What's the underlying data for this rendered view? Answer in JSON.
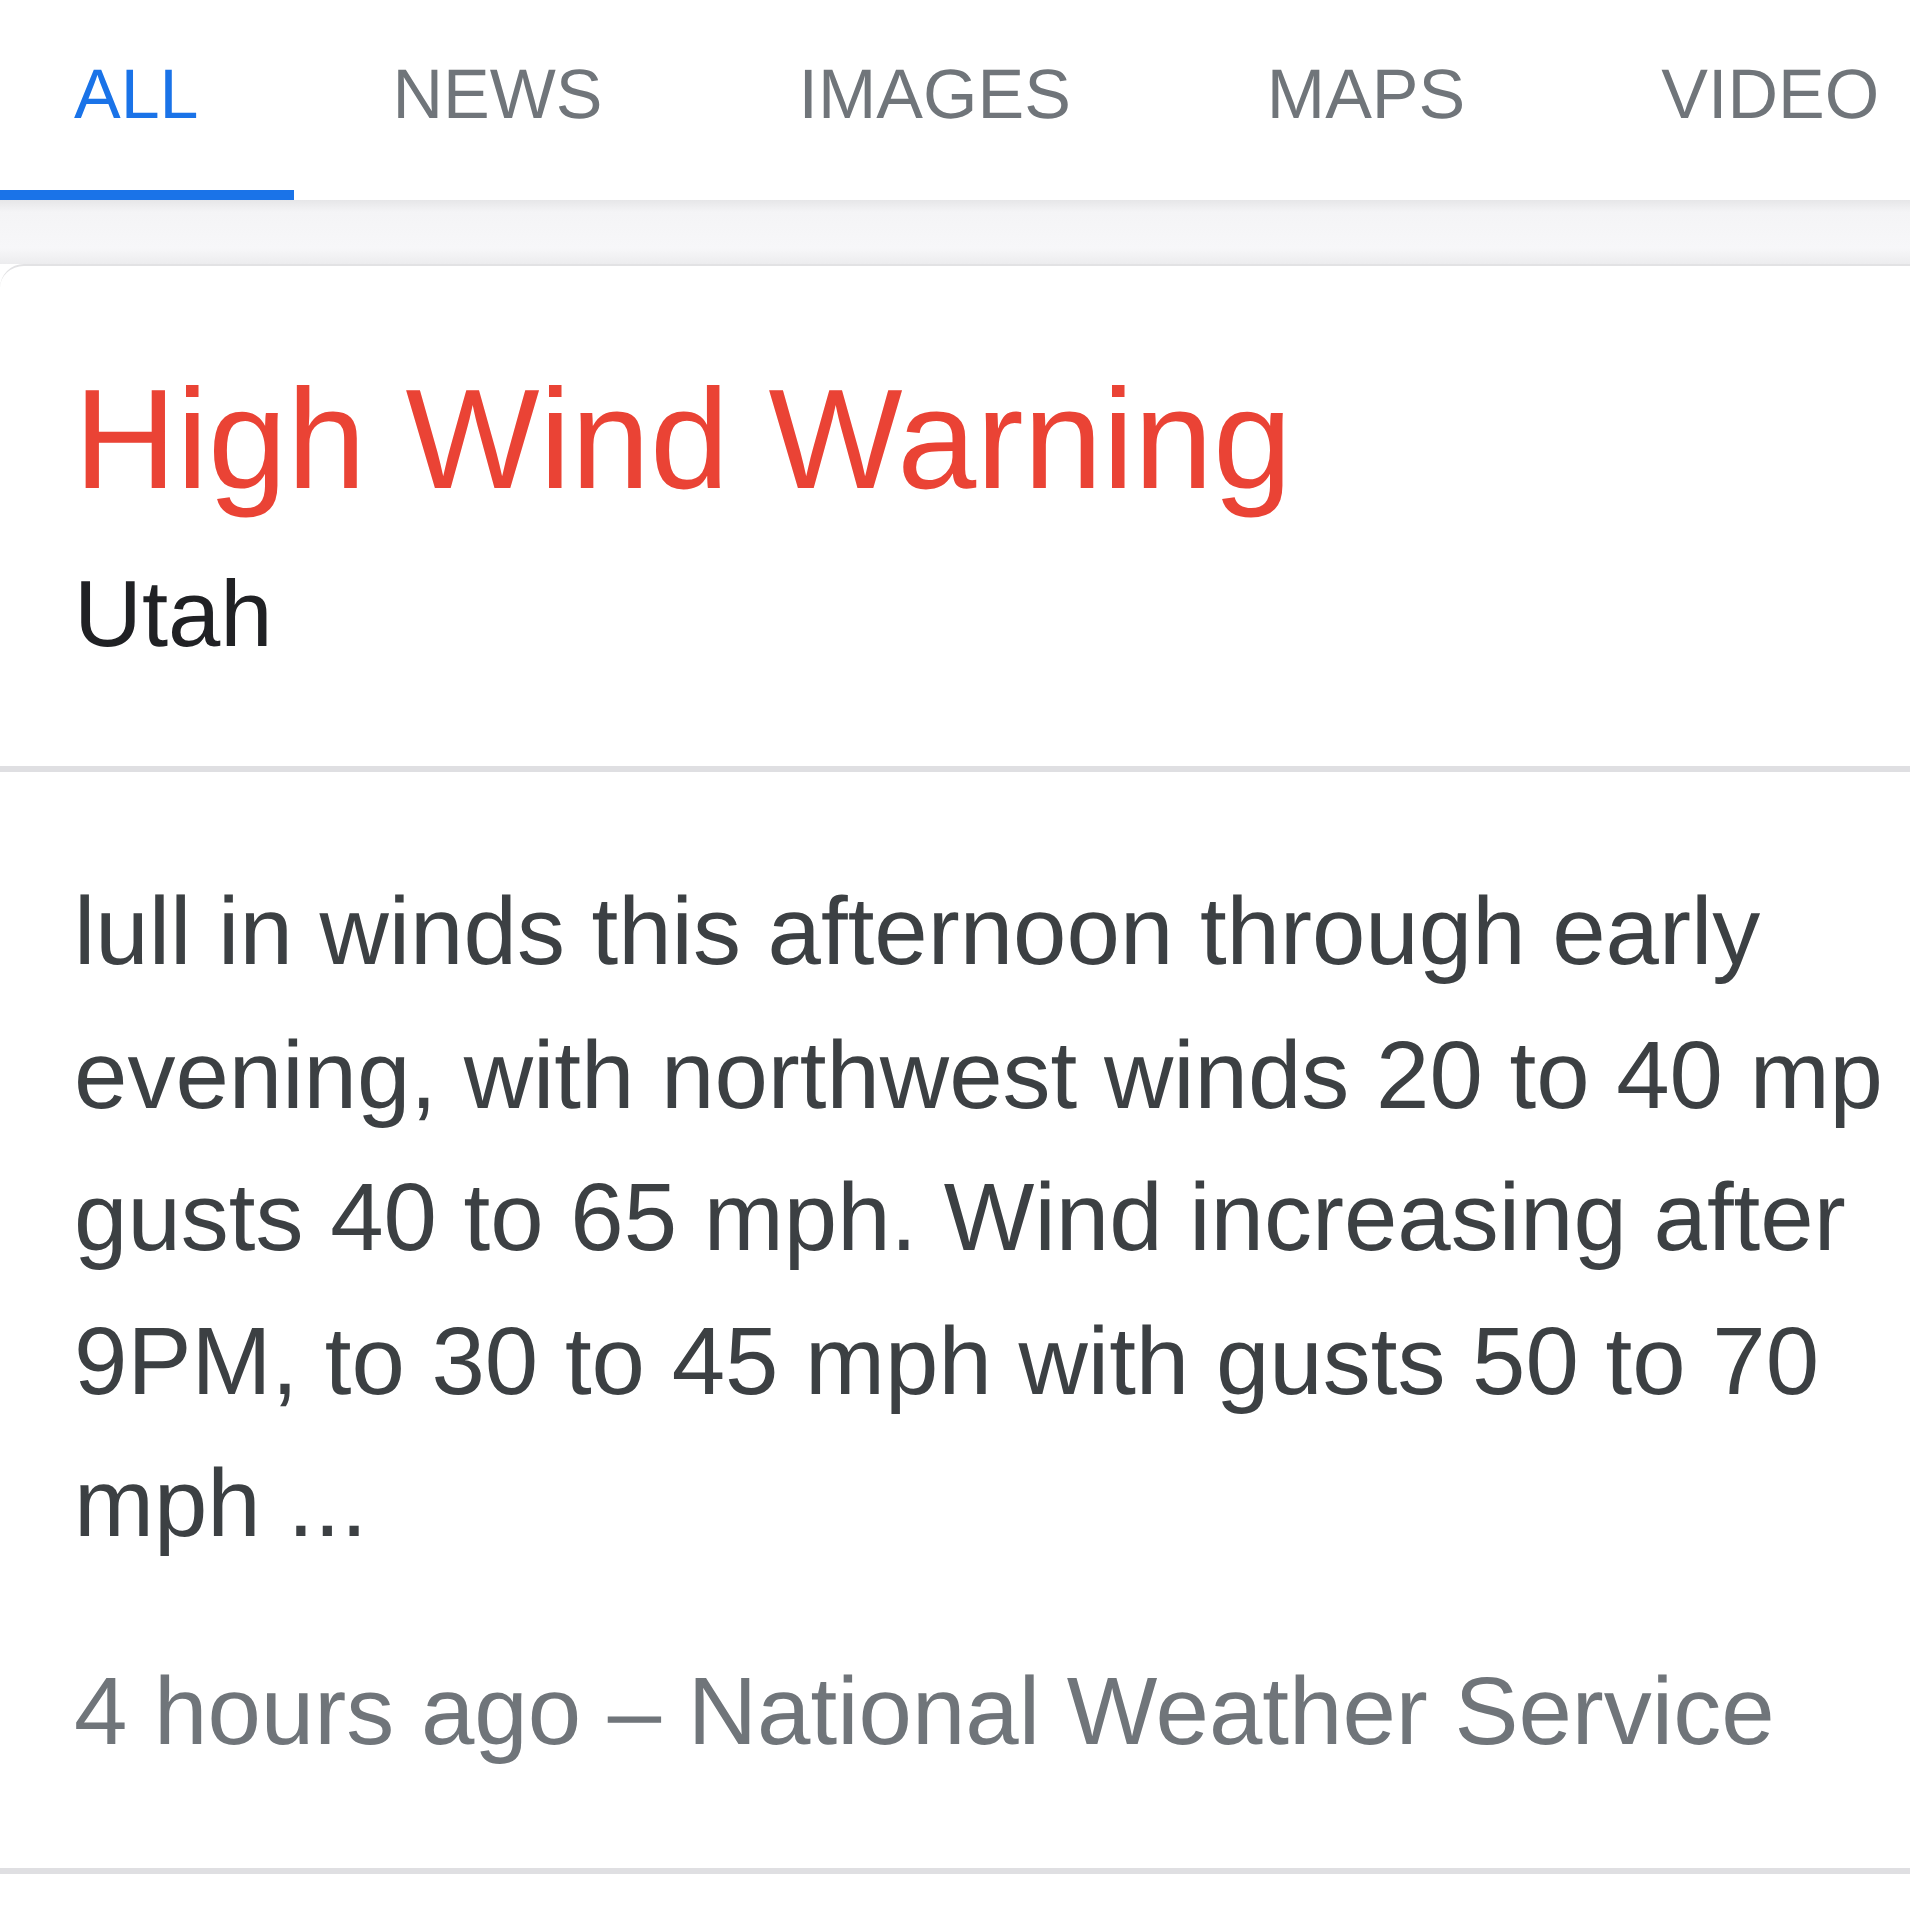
{
  "tabs": [
    {
      "label": "ALL",
      "selected": true
    },
    {
      "label": "NEWS",
      "selected": false
    },
    {
      "label": "IMAGES",
      "selected": false
    },
    {
      "label": "MAPS",
      "selected": false
    },
    {
      "label": "VIDEO",
      "selected": false
    }
  ],
  "result": {
    "title": "High Wind Warning",
    "subtitle": "Utah",
    "snippet_lines": [
      "lull in winds this afternoon through early",
      "evening, with northwest winds 20 to 40 mp",
      "gusts 40 to 65 mph. Wind increasing after",
      "9PM, to 30 to 45 mph with gusts 50 to 70",
      "mph ..."
    ],
    "footer": "4 hours ago – National Weather Service"
  }
}
